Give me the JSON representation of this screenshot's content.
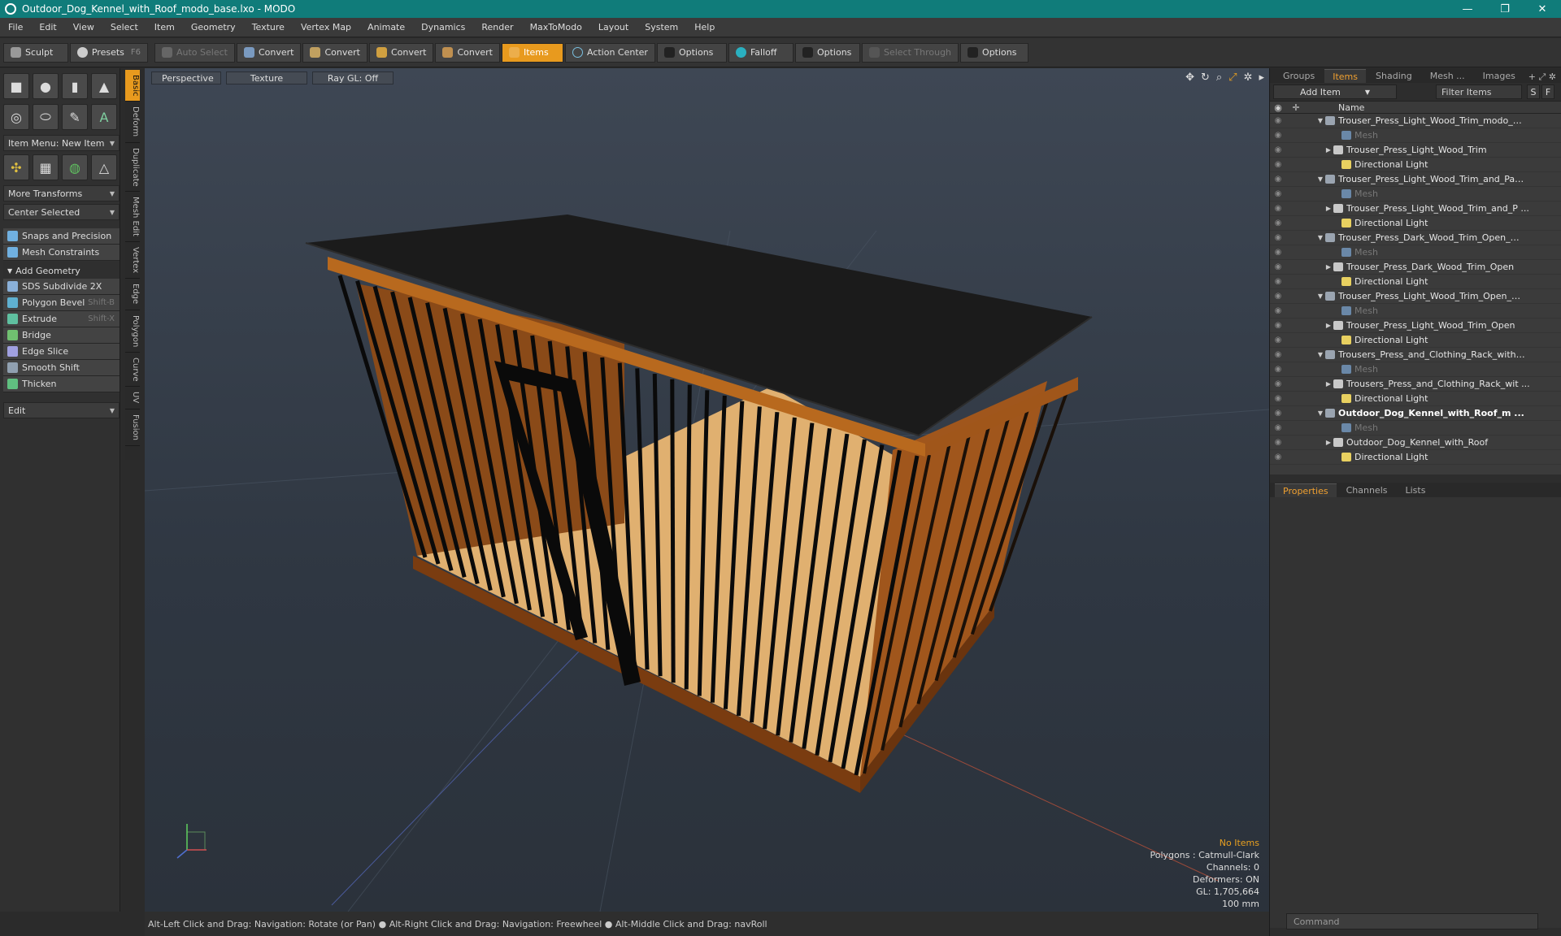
{
  "window": {
    "title": "Outdoor_Dog_Kennel_with_Roof_modo_base.lxo - MODO",
    "controls": [
      "—",
      "❐",
      "✕"
    ]
  },
  "menu": [
    "File",
    "Edit",
    "View",
    "Select",
    "Item",
    "Geometry",
    "Texture",
    "Vertex Map",
    "Animate",
    "Dynamics",
    "Render",
    "MaxToModo",
    "Layout",
    "System",
    "Help"
  ],
  "toolbar": {
    "sculpt": "Sculpt",
    "presets": "Presets",
    "presets_shortcut": "F6",
    "auto_select": "Auto Select",
    "convert1": "Convert",
    "convert2": "Convert",
    "convert3": "Convert",
    "convert4": "Convert",
    "items": "Items",
    "action_center": "Action Center",
    "options1": "Options",
    "falloff": "Falloff",
    "options2": "Options",
    "select_through": "Select Through",
    "options3": "Options"
  },
  "left": {
    "item_menu": "Item Menu: New Item",
    "more_transforms": "More Transforms",
    "center_selected": "Center Selected",
    "snaps": "Snaps and Precision",
    "mesh_constraints": "Mesh Constraints",
    "add_geometry": "Add Geometry",
    "tools": [
      {
        "label": "SDS Subdivide 2X",
        "shortcut": ""
      },
      {
        "label": "Polygon Bevel",
        "shortcut": "Shift-B"
      },
      {
        "label": "Extrude",
        "shortcut": "Shift-X"
      },
      {
        "label": "Bridge",
        "shortcut": ""
      },
      {
        "label": "Edge Slice",
        "shortcut": ""
      },
      {
        "label": "Smooth Shift",
        "shortcut": ""
      },
      {
        "label": "Thicken",
        "shortcut": ""
      }
    ],
    "edit": "Edit"
  },
  "vtabs": [
    "Basic",
    "Deform",
    "Duplicate",
    "Mesh Edit",
    "Vertex",
    "Edge",
    "Polygon",
    "Curve",
    "UV",
    "Fusion"
  ],
  "viewport": {
    "view": "Perspective",
    "shading": "Texture",
    "raygl": "Ray GL: Off",
    "stats": {
      "no_items": "No Items",
      "polygons": "Polygons : Catmull-Clark",
      "channels": "Channels: 0",
      "deformers": "Deformers: ON",
      "gl": "GL: 1,705,664",
      "scale": "100 mm"
    }
  },
  "status": "Alt-Left Click and Drag: Navigation: Rotate (or Pan) ● Alt-Right Click and Drag: Navigation: Freewheel ● Alt-Middle Click and Drag: navRoll",
  "right": {
    "tabs": [
      "Groups",
      "Items",
      "Shading",
      "Mesh ...",
      "Images"
    ],
    "add_item": "Add Item",
    "filter": "Filter Items",
    "s_btn": "S",
    "f_btn": "F",
    "col_name": "Name",
    "tree": [
      {
        "label": "Trouser_Press_Light_Wood_Trim_modo_ba...",
        "type": "scene",
        "indent": 0
      },
      {
        "label": "Mesh",
        "type": "mesh",
        "indent": 2,
        "dim": true
      },
      {
        "label": "Trouser_Press_Light_Wood_Trim",
        "type": "item",
        "indent": 1
      },
      {
        "label": "Directional Light",
        "type": "light",
        "indent": 2
      },
      {
        "label": "Trouser_Press_Light_Wood_Trim_and_Pan ...",
        "type": "scene",
        "indent": 0
      },
      {
        "label": "Mesh",
        "type": "mesh",
        "indent": 2,
        "dim": true
      },
      {
        "label": "Trouser_Press_Light_Wood_Trim_and_P ...",
        "type": "item",
        "indent": 1
      },
      {
        "label": "Directional Light",
        "type": "light",
        "indent": 2
      },
      {
        "label": "Trouser_Press_Dark_Wood_Trim_Open_mo...",
        "type": "scene",
        "indent": 0
      },
      {
        "label": "Mesh",
        "type": "mesh",
        "indent": 2,
        "dim": true
      },
      {
        "label": "Trouser_Press_Dark_Wood_Trim_Open",
        "type": "item",
        "indent": 1
      },
      {
        "label": "Directional Light",
        "type": "light",
        "indent": 2
      },
      {
        "label": "Trouser_Press_Light_Wood_Trim_Open_m ...",
        "type": "scene",
        "indent": 0
      },
      {
        "label": "Mesh",
        "type": "mesh",
        "indent": 2,
        "dim": true
      },
      {
        "label": "Trouser_Press_Light_Wood_Trim_Open",
        "type": "item",
        "indent": 1
      },
      {
        "label": "Directional Light",
        "type": "light",
        "indent": 2
      },
      {
        "label": "Trousers_Press_and_Clothing_Rack_with_ ...",
        "type": "scene",
        "indent": 0
      },
      {
        "label": "Mesh",
        "type": "mesh",
        "indent": 2,
        "dim": true
      },
      {
        "label": "Trousers_Press_and_Clothing_Rack_wit ...",
        "type": "item",
        "indent": 1
      },
      {
        "label": "Directional Light",
        "type": "light",
        "indent": 2
      },
      {
        "label": "Outdoor_Dog_Kennel_with_Roof_m ...",
        "type": "scene",
        "indent": 0,
        "bold": true
      },
      {
        "label": "Mesh",
        "type": "mesh",
        "indent": 2,
        "dim": true
      },
      {
        "label": "Outdoor_Dog_Kennel_with_Roof",
        "type": "item",
        "indent": 1
      },
      {
        "label": "Directional Light",
        "type": "light",
        "indent": 2
      }
    ],
    "props_tabs": [
      "Properties",
      "Channels",
      "Lists"
    ],
    "command": "Command"
  },
  "colors": {
    "accent": "#e89a1e",
    "titlebar": "#107c7a"
  }
}
